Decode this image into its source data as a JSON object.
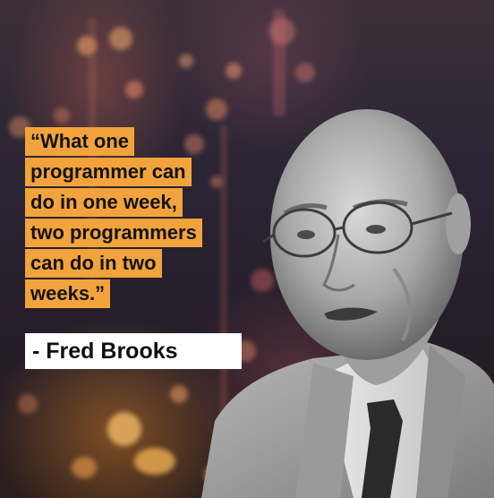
{
  "quote": {
    "lines": [
      "“What one",
      "programmer can",
      "do in one week,",
      "two programmers",
      "can do in two",
      "weeks.”"
    ]
  },
  "author": "- Fred Brooks",
  "colors": {
    "quote_highlight": "#f2a33c",
    "author_box": "#ffffff",
    "text": "#121212"
  }
}
